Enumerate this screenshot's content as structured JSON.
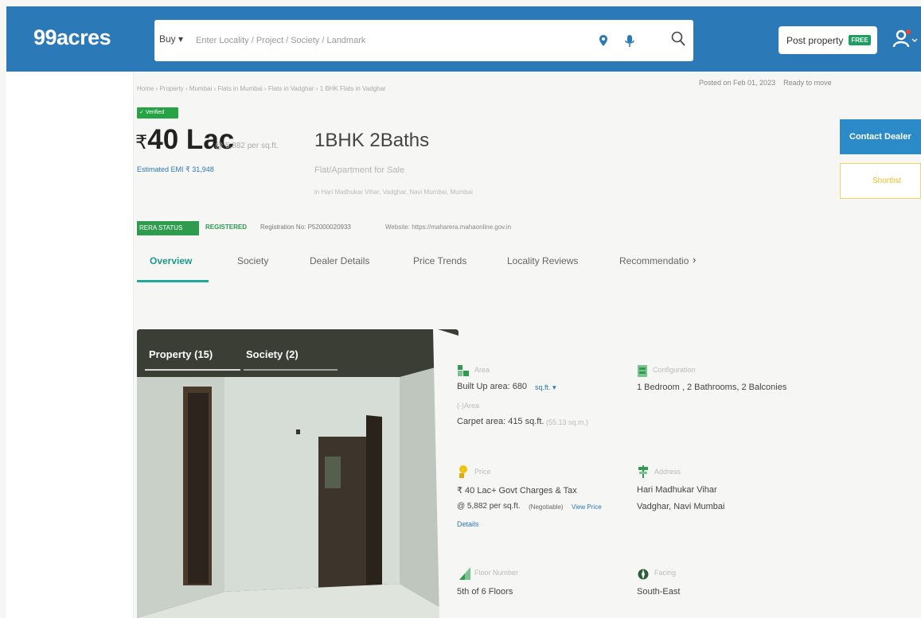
{
  "header": {
    "logo": "99acres",
    "search": {
      "type": "Buy ▾",
      "placeholder": "Enter Locality / Project / Society / Landmark"
    },
    "post_property": "Post property",
    "free_badge": "FREE"
  },
  "breadcrumb": "Home › Property › Mumbai › Flats in Mumbai › Flats in Vadghar › 1 BHK Flats in Vadghar",
  "meta": {
    "posted": "Posted on Feb 01, 2023",
    "status": "Ready to move"
  },
  "listing": {
    "verified": "✓ Verified",
    "currency": "₹",
    "price": "40 Lac",
    "price_per_sqft": "@ 5,882 per sq.ft.",
    "emi": "Estimated EMI ₹ 31,948",
    "title": "1BHK 2Baths",
    "subtitle": "Flat/Apartment for Sale",
    "address": "in Hari Madhukar Vihar, Vadghar, Navi Mumbai, Mumbai"
  },
  "actions": {
    "contact": "Contact Dealer",
    "shortlist": "Shortlist"
  },
  "rera": {
    "badge": "RERA STATUS",
    "status": "REGISTERED",
    "registration": "Registration No: P52000020933",
    "website": "Website: https://maharera.mahaonline.gov.in"
  },
  "tabs": [
    "Overview",
    "Society",
    "Dealer Details",
    "Price Trends",
    "Locality Reviews",
    "Recommendatio",
    "›"
  ],
  "gallery": {
    "tab_property": "Property (15)",
    "tab_society": "Society (2)"
  },
  "details": {
    "area_label": "Area",
    "built_up": "Built Up area: 680",
    "unit": "sq.ft. ▾",
    "carpet_sub": "(-)Area",
    "carpet": "Carpet area: 415 sq.ft.",
    "carpet_extra": "(55.13 sq.m.)",
    "config_label": "Configuration",
    "config": "1 Bedroom , 2 Bathrooms, 2 Balconies",
    "price_label": "Price",
    "price": "₹ 40 Lac+ Govt Charges & Tax",
    "price_sqft": "@ 5,882 per sq.ft.",
    "negotiable": "(Negotiable)",
    "view_price": "View Price",
    "details_link": "Details",
    "address_label": "Address",
    "address_1": "Hari Madhukar Vihar",
    "address_2": "Vadghar, Navi Mumbai",
    "floor_label": "Floor Number",
    "floor": "5th of 6 Floors",
    "facing_label": "Facing",
    "facing": "South-East"
  },
  "colors": {
    "header": "#2c79b8",
    "accent_green": "#1b9f60",
    "tab_active": "#1f9a8a",
    "contact": "#2b8bc8"
  }
}
